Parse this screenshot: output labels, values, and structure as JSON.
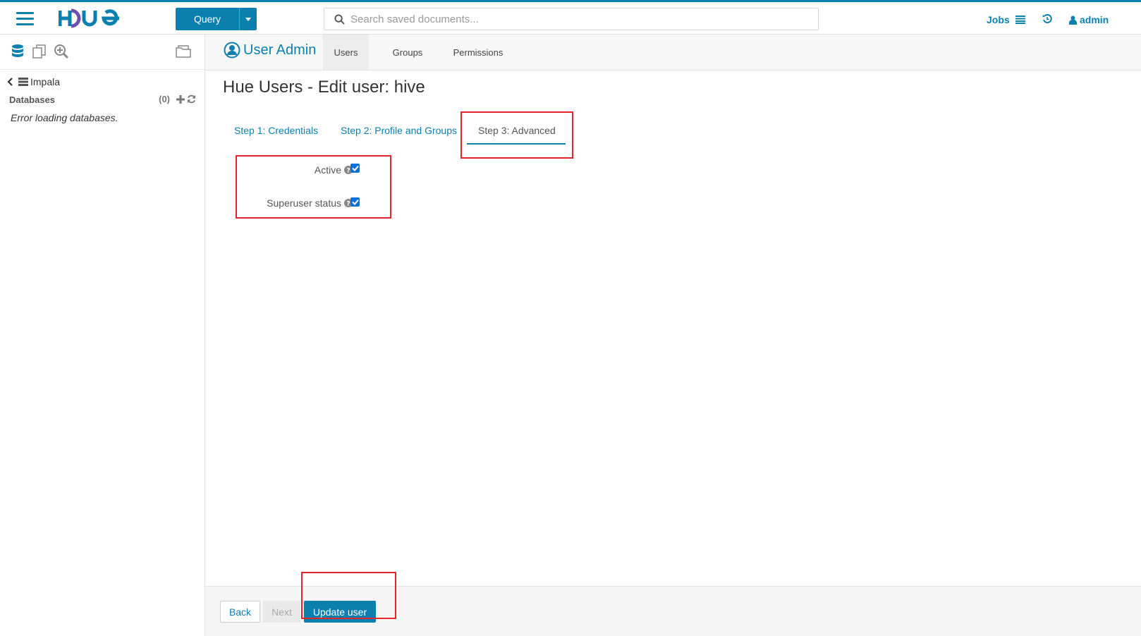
{
  "app": {
    "logo_text": "HUE",
    "query_button": "Query",
    "search_placeholder": "Search saved documents...",
    "jobs_label": "Jobs",
    "user_label": "admin",
    "accent_color": "#0B7FAD"
  },
  "sidebar": {
    "source_label": "Impala",
    "databases_label": "Databases",
    "databases_count": "(0)",
    "error_text": "Error loading databases."
  },
  "subheader": {
    "app_title": "User Admin",
    "tabs": [
      {
        "label": "Users",
        "active": true
      },
      {
        "label": "Groups",
        "active": false
      },
      {
        "label": "Permissions",
        "active": false
      }
    ]
  },
  "main": {
    "page_title": "Hue Users - Edit user: hive",
    "steps": [
      {
        "label": "Step 1: Credentials",
        "current": false
      },
      {
        "label": "Step 2: Profile and Groups",
        "current": false
      },
      {
        "label": "Step 3: Advanced",
        "current": true
      }
    ],
    "fields": [
      {
        "label": "Active",
        "checked": true
      },
      {
        "label": "Superuser status",
        "checked": true
      }
    ]
  },
  "footer": {
    "back_label": "Back",
    "next_label": "Next",
    "update_label": "Update user"
  },
  "highlight_color": "#e3262b"
}
